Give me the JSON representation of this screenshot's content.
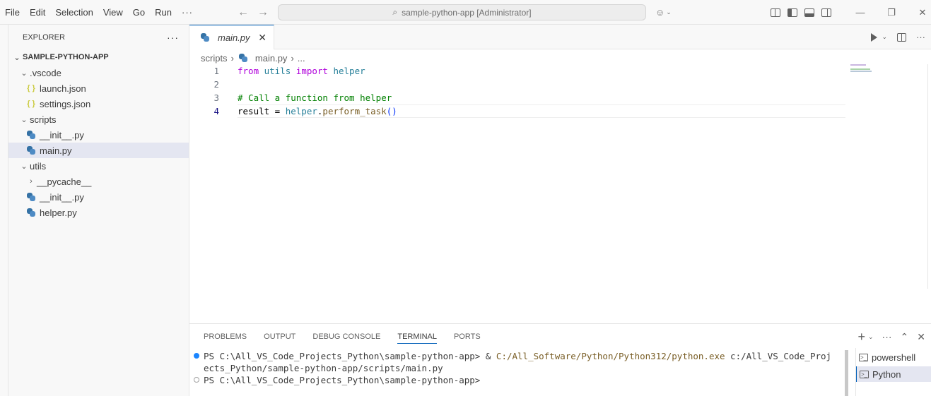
{
  "menu": [
    "File",
    "Edit",
    "Selection",
    "View",
    "Go",
    "Run"
  ],
  "menu_more": "···",
  "command_center": {
    "text": "sample-python-app [Administrator]"
  },
  "sidebar": {
    "title": "EXPLORER",
    "more": "···",
    "root": "SAMPLE-PYTHON-APP",
    "items": [
      {
        "label": ".vscode"
      },
      {
        "label": "launch.json"
      },
      {
        "label": "settings.json"
      },
      {
        "label": "scripts"
      },
      {
        "label": "__init__.py"
      },
      {
        "label": "main.py"
      },
      {
        "label": "utils"
      },
      {
        "label": "__pycache__"
      },
      {
        "label": "__init__.py"
      },
      {
        "label": "helper.py"
      }
    ]
  },
  "editor": {
    "tab": {
      "label": "main.py"
    },
    "breadcrumb": [
      "scripts",
      "main.py",
      "..."
    ],
    "line_numbers": [
      "1",
      "2",
      "3",
      "4"
    ],
    "code": {
      "l1": {
        "from": "from",
        "utils": " utils ",
        "import": "import",
        "helper": " helper"
      },
      "l3": {
        "comment": "# Call a function from helper"
      },
      "l4": {
        "result": "result = ",
        "helper": "helper",
        "dot": ".",
        "fn": "perform_task",
        "paren": "()"
      }
    }
  },
  "panel": {
    "tabs": [
      "PROBLEMS",
      "OUTPUT",
      "DEBUG CONSOLE",
      "TERMINAL",
      "PORTS"
    ],
    "terminal": {
      "line1_prompt": "PS C:\\All_VS_Code_Projects_Python\\sample-python-app> & ",
      "line1_exe": "C:/All_Software/Python/Python312/python.exe",
      "line1_arg": " c:/All_VS_Code_Proj",
      "line2": "ects_Python/sample-python-app/scripts/main.py",
      "line3": "PS C:\\All_VS_Code_Projects_Python\\sample-python-app>"
    },
    "terminals": [
      "powershell",
      "Python"
    ]
  }
}
